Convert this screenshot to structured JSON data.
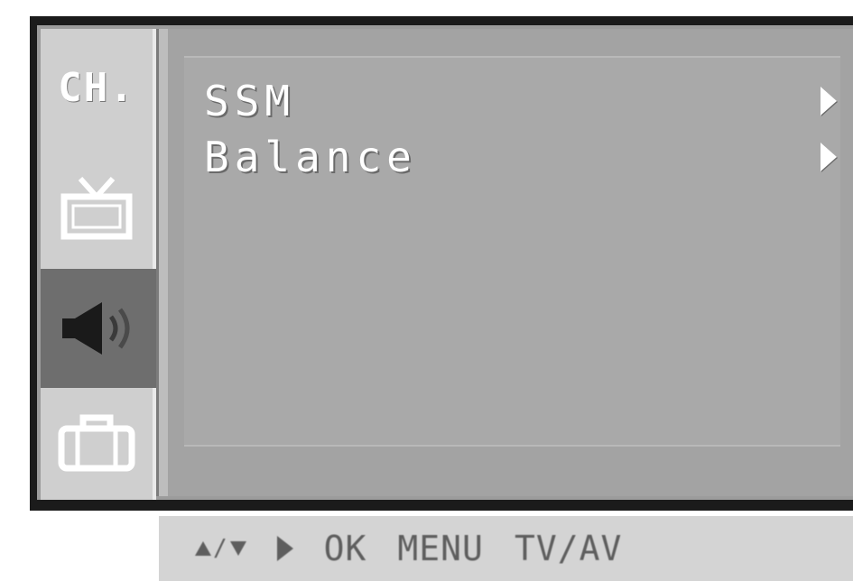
{
  "tabs": [
    {
      "id": "channel",
      "label": "CH.",
      "icon": "",
      "active": false
    },
    {
      "id": "picture",
      "label": "",
      "icon": "tv-icon",
      "active": false
    },
    {
      "id": "sound",
      "label": "",
      "icon": "speaker-icon",
      "active": true
    },
    {
      "id": "special",
      "label": "",
      "icon": "toolbox-icon",
      "active": false
    }
  ],
  "menu": {
    "items": [
      {
        "label": "SSM",
        "icon": "arrow-right-icon"
      },
      {
        "label": "Balance",
        "icon": "arrow-right-icon"
      }
    ]
  },
  "keybar": {
    "updown_icon": "up-down-arrows-icon",
    "right_icon": "right-arrow-icon",
    "ok_label": "OK",
    "menu_label": "MENU",
    "tvav_label": "TV/AV"
  },
  "colors": {
    "frame": "#1b1b1b",
    "panel": "#a3a3a3",
    "tab_inactive": "#cfcfcf",
    "tab_active": "#6e6e6e",
    "text": "#ffffff",
    "keybar": "#d4d4d4"
  }
}
